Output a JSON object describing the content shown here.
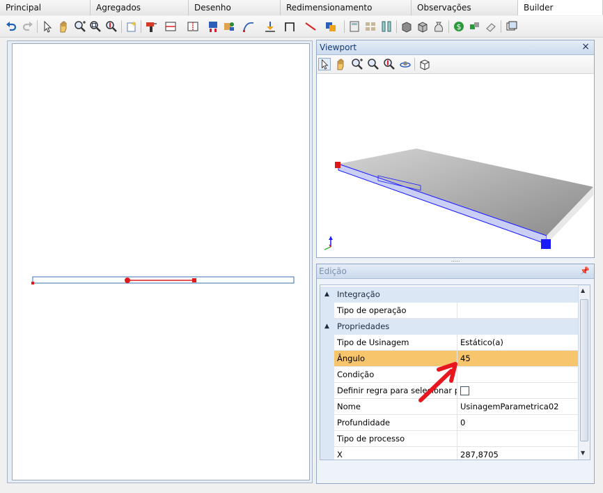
{
  "tabs": [
    "Principal",
    "Agregados",
    "Desenho",
    "Redimensionamento",
    "Observações",
    "Builder"
  ],
  "toolbar_icons": [
    "undo-icon",
    "redo-icon",
    "select-arrow-icon",
    "pan-hand-icon",
    "zoom-in-icon",
    "zoom-window-icon",
    "zoom-extents-icon",
    "new-item-icon",
    "drill-icon",
    "panel-horizontal-icon",
    "panel-vertical-icon",
    "hardware-icon",
    "shelf-icon",
    "curve-icon",
    "arrow-down-icon",
    "frame-icon",
    "line-icon",
    "color-fill-icon",
    "calculator-icon",
    "grid-icon",
    "columns-icon",
    "box-icon",
    "cube-icon",
    "money-bag-icon",
    "dollar-icon",
    "blocks-icon",
    "eraser-icon",
    "window-icon"
  ],
  "viewport": {
    "title": "Viewport",
    "close": "×",
    "tools": [
      "select-arrow-icon",
      "pan-hand-icon",
      "zoom-in-icon",
      "zoom-window-icon",
      "zoom-extents-icon",
      "orbit-icon",
      "view-cube-icon"
    ]
  },
  "edicao": {
    "title": "Edição",
    "rows": [
      {
        "type": "category",
        "label": "Integração"
      },
      {
        "type": "prop",
        "name": "Tipo de operação",
        "value": ""
      },
      {
        "type": "category",
        "label": "Propriedades"
      },
      {
        "type": "prop",
        "name": "Tipo de Usinagem",
        "value": "Estático(a)"
      },
      {
        "type": "prop",
        "name": "Ângulo",
        "value": "45",
        "selected": true
      },
      {
        "type": "prop",
        "name": "Condição",
        "value": ""
      },
      {
        "type": "prop",
        "name": "Definir regra para selecionar pro...",
        "value": "",
        "checkbox": true
      },
      {
        "type": "prop",
        "name": "Nome",
        "value": "UsinagemParametrica02"
      },
      {
        "type": "prop",
        "name": "Profundidade",
        "value": "0"
      },
      {
        "type": "prop",
        "name": "Tipo de processo",
        "value": ""
      },
      {
        "type": "prop",
        "name": "X",
        "value": "287,8705"
      }
    ]
  },
  "colors": {
    "accent_selected_row": "#f6c56c",
    "annotation_arrow": "#e8161f",
    "panel_edge": "#1a1aff"
  }
}
